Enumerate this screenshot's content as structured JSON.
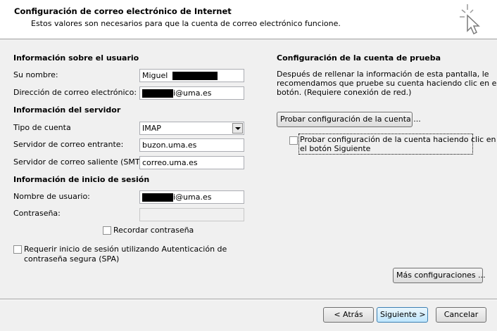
{
  "header": {
    "title": "Configuración de correo electrónico de Internet",
    "subtitle": "Estos valores son necesarios para que la cuenta de correo electrónico funcione."
  },
  "user_info": {
    "section": "Información sobre el usuario",
    "name_label": "Su nombre:",
    "name_value": "Miguel",
    "email_label": "Dirección de correo electrónico:",
    "email_value": "i@uma.es"
  },
  "server_info": {
    "section": "Información del servidor",
    "account_type_label": "Tipo de cuenta",
    "account_type_value": "IMAP",
    "incoming_label": "Servidor de correo entrante:",
    "incoming_value": "buzon.uma.es",
    "outgoing_label": "Servidor de correo saliente (SMTP):",
    "outgoing_value": "correo.uma.es"
  },
  "login_info": {
    "section": "Información de inicio de sesión",
    "username_label": "Nombre de usuario:",
    "username_value": "i@uma.es",
    "password_label": "Contraseña:",
    "password_value": "",
    "remember_label": "Recordar contraseña",
    "spa_label_line1": "Requerir inicio de sesión utilizando Autenticación de",
    "spa_label_line2": "contraseña segura (SPA)"
  },
  "test_config": {
    "section": "Configuración de la cuenta de prueba",
    "description_line1": "Después de rellenar la información de esta pantalla, le",
    "description_line2": "recomendamos que pruebe su cuenta haciendo clic en el",
    "description_line3": "botón. (Requiere conexión de red.)",
    "test_button": "Probar configuración de la cuenta ...",
    "auto_test_line1": "Probar configuración de la cuenta haciendo clic en",
    "auto_test_line2": "el botón Siguiente"
  },
  "more_settings_button": "Más configuraciones ...",
  "footer": {
    "back_button": "< Atrás",
    "next_button": "Siguiente >",
    "cancel_button": "Cancelar"
  }
}
